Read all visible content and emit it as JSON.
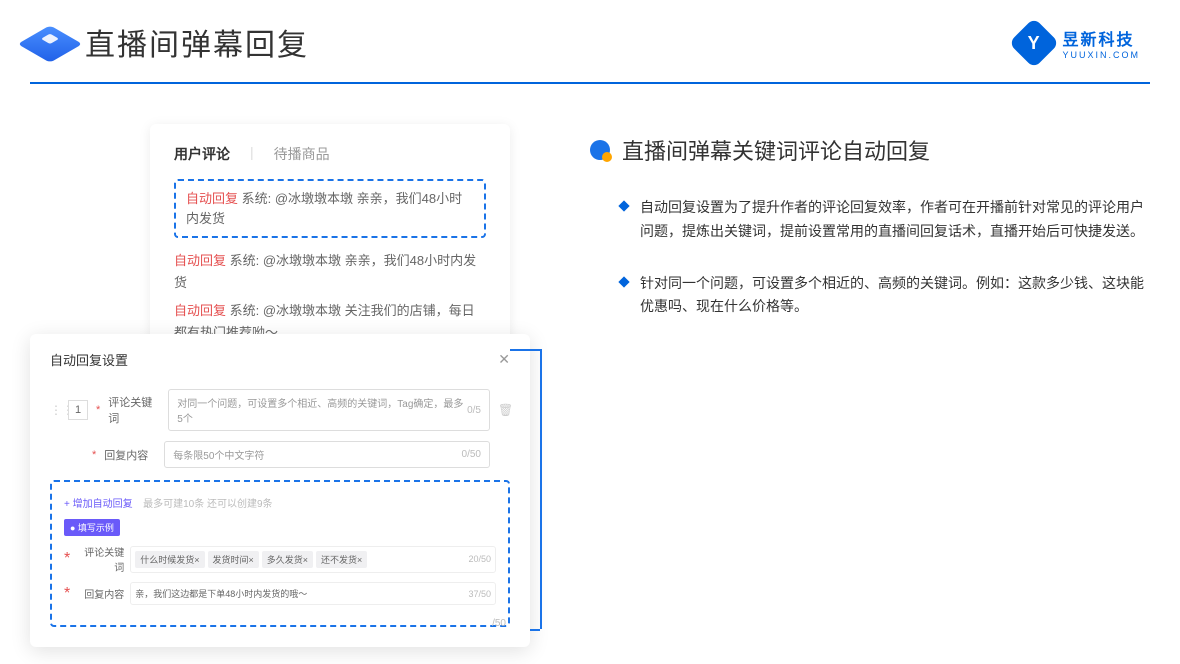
{
  "header": {
    "title": "直播间弹幕回复"
  },
  "brand": {
    "name": "昱新科技",
    "url": "YUUXIN.COM"
  },
  "comments": {
    "tab_active": "用户评论",
    "tab_other": "待播商品",
    "highlighted": "自动回复 系统: @冰墩墩本墩 亲亲，我们48小时内发货",
    "item1": "自动回复 系统: @冰墩墩本墩 亲亲，我们48小时内发货",
    "item2": "自动回复 系统: @冰墩墩本墩 关注我们的店铺，每日都有热门推荐呦～",
    "auto_tag": "自动回复"
  },
  "settings": {
    "title": "自动回复设置",
    "num": "1",
    "keyword_label": "评论关键词",
    "keyword_placeholder": "对同一个问题，可设置多个相近、高频的关键词，Tag确定，最多5个",
    "keyword_counter": "0/5",
    "content_label": "回复内容",
    "content_placeholder": "每条限50个中文字符",
    "content_counter": "0/50",
    "add_link": "+ 增加自动回复",
    "add_hint": "最多可建10条 还可以创建9条",
    "example_badge": "● 填写示例",
    "ex_keyword_label": "评论关键词",
    "ex_content_label": "回复内容",
    "tag1": "什么时候发货×",
    "tag2": "发货时间×",
    "tag3": "多久发货×",
    "tag4": "还不发货×",
    "ex_kw_counter": "20/50",
    "ex_content": "亲，我们这边都是下单48小时内发货的哦～",
    "ex_content_counter": "37/50",
    "bottom_counter": "/50"
  },
  "right": {
    "heading": "直播间弹幕关键词评论自动回复",
    "bullet1": "自动回复设置为了提升作者的评论回复效率，作者可在开播前针对常见的评论用户问题，提炼出关键词，提前设置常用的直播间回复话术，直播开始后可快捷发送。",
    "bullet2": "针对同一个问题，可设置多个相近的、高频的关键词。例如：这款多少钱、这块能优惠吗、现在什么价格等。"
  }
}
